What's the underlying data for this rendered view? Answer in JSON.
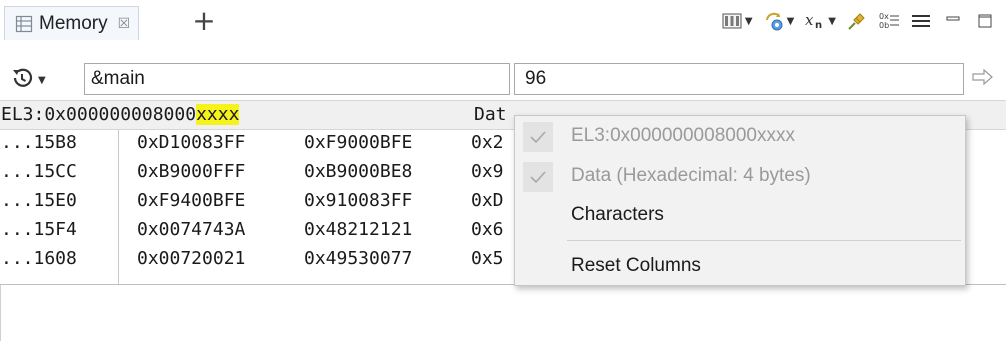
{
  "view": {
    "tab_label": "Memory",
    "tab_close_glyph": "☒",
    "tab_add_glyph": "+",
    "toolbar_icons": [
      "columns-icon",
      "refresh-settings-icon",
      "xn-format-icon",
      "pin-icon",
      "hex-format-icon",
      "view-menu-icon",
      "minimize-icon",
      "maximize-icon"
    ]
  },
  "address_bar": {
    "history_icon": "history-icon",
    "address_value": "&main",
    "length_value": "96",
    "go_icon": "go-arrow-icon"
  },
  "header": {
    "address_prefix": "EL3:0x000000008000",
    "address_highlight": "xxxx",
    "data_label": "Dat"
  },
  "rows": [
    {
      "addr": "...15B8",
      "v1": "0xD10083FF",
      "v2": "0xF9000BFE",
      "v3": "0x2"
    },
    {
      "addr": "...15CC",
      "v1": "0xB9000FFF",
      "v2": "0xB9000BE8",
      "v3": "0x9"
    },
    {
      "addr": "...15E0",
      "v1": "0xF9400BFE",
      "v2": "0x910083FF",
      "v3": "0xD"
    },
    {
      "addr": "...15F4",
      "v1": "0x0074743A",
      "v2": "0x48212121",
      "v3": "0x6"
    },
    {
      "addr": "...1608",
      "v1": "0x00720021",
      "v2": "0x49530077",
      "v3": "0x5"
    }
  ],
  "context_menu": {
    "items": [
      {
        "label": "EL3:0x000000008000xxxx",
        "checked": true,
        "disabled": true
      },
      {
        "label": "Data (Hexadecimal: 4 bytes)",
        "checked": true,
        "disabled": true
      },
      {
        "label": "Characters",
        "checked": false,
        "disabled": false
      },
      {
        "label": "Reset Columns",
        "checked": false,
        "disabled": false
      }
    ]
  },
  "colors": {
    "highlight": "#f6f21b",
    "header_bg": "#f0f0f0",
    "menu_bg": "#f2f2f2"
  }
}
